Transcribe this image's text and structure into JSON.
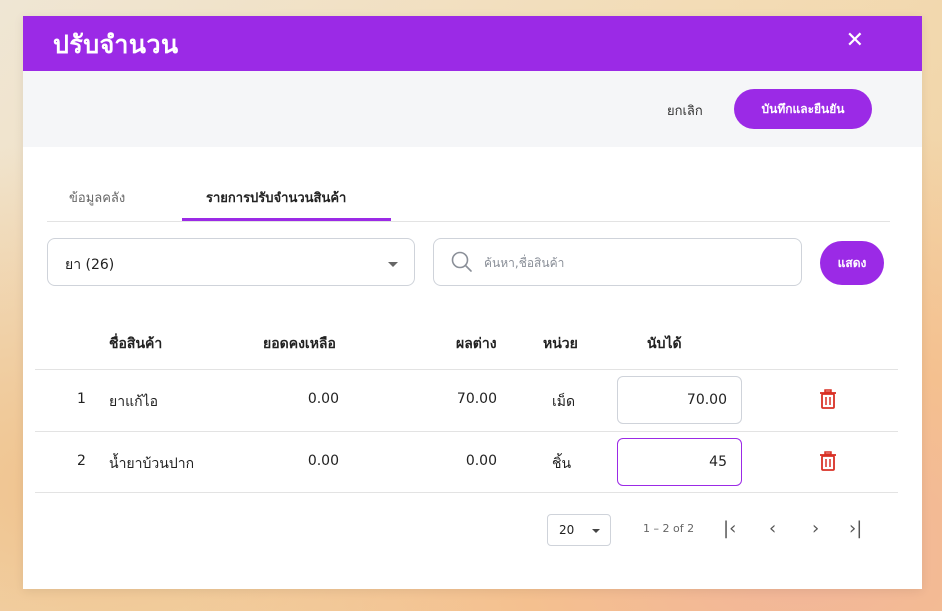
{
  "dialog": {
    "title": "ปรับจำนวน",
    "close_icon": "close-icon"
  },
  "actions": {
    "cancel_label": "ยกเลิก",
    "save_label": "บันทึกและยืนยัน"
  },
  "tabs": [
    {
      "label": "ข้อมูลคลัง",
      "active": false
    },
    {
      "label": "รายการปรับจำนวนสินค้า",
      "active": true
    }
  ],
  "filter": {
    "category_value": "ยา (26)",
    "search_placeholder": "ค้นหา,ชื่อสินค้า",
    "search_value": "",
    "show_label": "แสดง"
  },
  "table": {
    "headers": {
      "name": "ชื่อสินค้า",
      "remaining": "ยอดคงเหลือ",
      "difference": "ผลต่าง",
      "unit": "หน่วย",
      "counted": "นับได้"
    },
    "rows": [
      {
        "index": "1",
        "name": "ยาแก้ไอ",
        "remaining": "0.00",
        "difference": "70.00",
        "unit": "เม็ด",
        "counted": "70.00",
        "delete_icon": "trash-icon"
      },
      {
        "index": "2",
        "name": "น้ำยาบ้วนปาก",
        "remaining": "0.00",
        "difference": "0.00",
        "unit": "ชิ้น",
        "counted": "45",
        "delete_icon": "trash-icon"
      }
    ]
  },
  "pagination": {
    "page_size": "20",
    "range": "1 – 2 of 2"
  },
  "colors": {
    "accent": "#9b2ae6",
    "delete": "#d93025"
  }
}
